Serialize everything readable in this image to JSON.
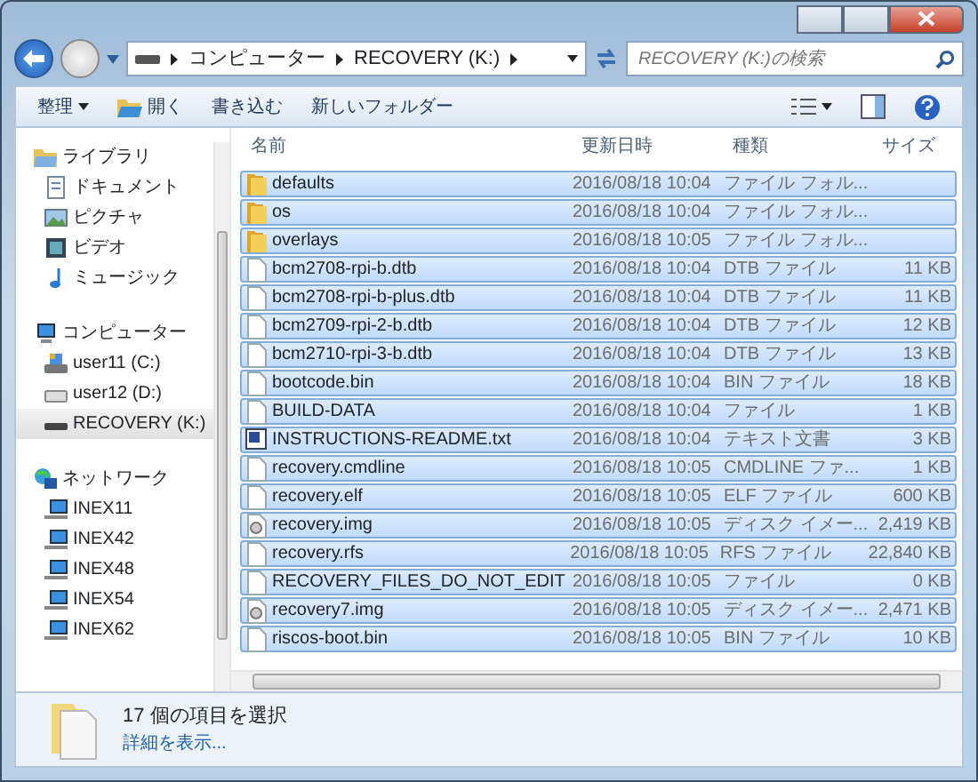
{
  "address": {
    "crumbs": [
      "コンピューター",
      "RECOVERY (K:)"
    ]
  },
  "search": {
    "placeholder": "RECOVERY (K:)の検索"
  },
  "toolbar": [
    "整理",
    "開く",
    "書き込む",
    "新しいフォルダー"
  ],
  "nav": [
    {
      "label": "ライブラリ",
      "kind": "library",
      "selected": false,
      "children": [
        {
          "label": "ドキュメント",
          "kind": "document",
          "selected": false
        },
        {
          "label": "ピクチャ",
          "kind": "picture",
          "selected": false
        },
        {
          "label": "ビデオ",
          "kind": "video",
          "selected": false
        },
        {
          "label": "ミュージック",
          "kind": "music",
          "selected": false
        }
      ]
    },
    {
      "label": "コンピューター",
      "kind": "computer",
      "selected": false,
      "children": [
        {
          "label": "user11 (C:)",
          "kind": "sysdrive",
          "selected": false
        },
        {
          "label": "user12 (D:)",
          "kind": "drive",
          "selected": false
        },
        {
          "label": "RECOVERY (K:)",
          "kind": "removable",
          "selected": true
        }
      ]
    },
    {
      "label": "ネットワーク",
      "kind": "network",
      "selected": false,
      "children": [
        {
          "label": "INEX11",
          "kind": "pc",
          "selected": false
        },
        {
          "label": "INEX42",
          "kind": "pc",
          "selected": false
        },
        {
          "label": "INEX48",
          "kind": "pc",
          "selected": false
        },
        {
          "label": "INEX54",
          "kind": "pc",
          "selected": false
        },
        {
          "label": "INEX62",
          "kind": "pc",
          "selected": false
        }
      ]
    }
  ],
  "table": {
    "columns": [
      "名前",
      "更新日時",
      "種類",
      "サイズ"
    ],
    "rows": [
      {
        "kind": "folder",
        "selected": true,
        "name": "defaults",
        "date": "2016/08/18 10:04",
        "type": "ファイル フォル...",
        "size": ""
      },
      {
        "kind": "folder",
        "selected": true,
        "name": "os",
        "date": "2016/08/18 10:04",
        "type": "ファイル フォル...",
        "size": ""
      },
      {
        "kind": "folder",
        "selected": true,
        "name": "overlays",
        "date": "2016/08/18 10:05",
        "type": "ファイル フォル...",
        "size": ""
      },
      {
        "kind": "file",
        "selected": true,
        "name": "bcm2708-rpi-b.dtb",
        "date": "2016/08/18 10:04",
        "type": "DTB ファイル",
        "size": "11 KB"
      },
      {
        "kind": "file",
        "selected": true,
        "name": "bcm2708-rpi-b-plus.dtb",
        "date": "2016/08/18 10:04",
        "type": "DTB ファイル",
        "size": "11 KB"
      },
      {
        "kind": "file",
        "selected": true,
        "name": "bcm2709-rpi-2-b.dtb",
        "date": "2016/08/18 10:04",
        "type": "DTB ファイル",
        "size": "12 KB"
      },
      {
        "kind": "file",
        "selected": true,
        "name": "bcm2710-rpi-3-b.dtb",
        "date": "2016/08/18 10:04",
        "type": "DTB ファイル",
        "size": "13 KB"
      },
      {
        "kind": "file",
        "selected": true,
        "name": "bootcode.bin",
        "date": "2016/08/18 10:04",
        "type": "BIN ファイル",
        "size": "18 KB"
      },
      {
        "kind": "file",
        "selected": true,
        "name": "BUILD-DATA",
        "date": "2016/08/18 10:04",
        "type": "ファイル",
        "size": "1 KB"
      },
      {
        "kind": "text",
        "selected": true,
        "name": "INSTRUCTIONS-README.txt",
        "date": "2016/08/18 10:04",
        "type": "テキスト文書",
        "size": "3 KB"
      },
      {
        "kind": "file",
        "selected": true,
        "name": "recovery.cmdline",
        "date": "2016/08/18 10:05",
        "type": "CMDLINE ファ...",
        "size": "1 KB"
      },
      {
        "kind": "file",
        "selected": true,
        "name": "recovery.elf",
        "date": "2016/08/18 10:05",
        "type": "ELF ファイル",
        "size": "600 KB"
      },
      {
        "kind": "image",
        "selected": true,
        "name": "recovery.img",
        "date": "2016/08/18 10:05",
        "type": "ディスク イメー...",
        "size": "2,419 KB"
      },
      {
        "kind": "file",
        "selected": true,
        "name": "recovery.rfs",
        "date": "2016/08/18 10:05",
        "type": "RFS ファイル",
        "size": "22,840 KB"
      },
      {
        "kind": "file",
        "selected": true,
        "name": "RECOVERY_FILES_DO_NOT_EDIT",
        "date": "2016/08/18 10:05",
        "type": "ファイル",
        "size": "0 KB"
      },
      {
        "kind": "image",
        "selected": true,
        "name": "recovery7.img",
        "date": "2016/08/18 10:05",
        "type": "ディスク イメー...",
        "size": "2,471 KB"
      },
      {
        "kind": "file",
        "selected": true,
        "name": "riscos-boot.bin",
        "date": "2016/08/18 10:05",
        "type": "BIN ファイル",
        "size": "10 KB"
      }
    ]
  },
  "details": {
    "summary": "17 個の項目を選択",
    "link": "詳細を表示..."
  }
}
